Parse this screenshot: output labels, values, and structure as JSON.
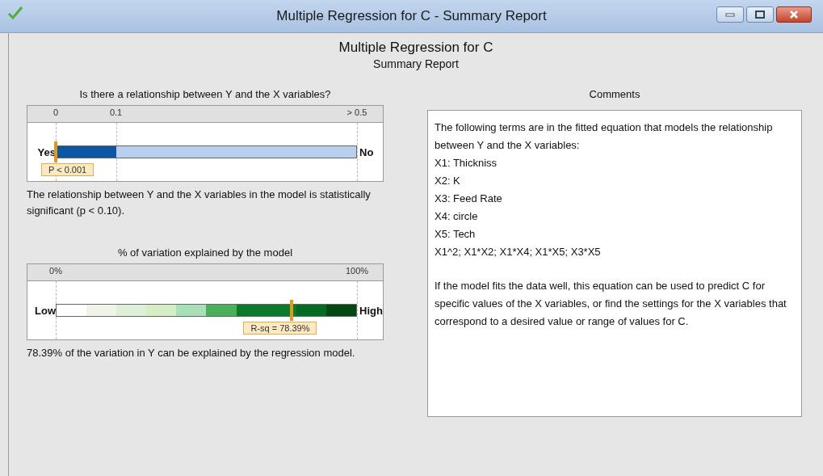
{
  "window": {
    "title": "Multiple Regression for C - Summary Report"
  },
  "report": {
    "title": "Multiple Regression for C",
    "subtitle": "Summary Report"
  },
  "relationship": {
    "question": "Is there a relationship between Y and the X variables?",
    "ticks": [
      "0",
      "0.1",
      "> 0.5"
    ],
    "left_label": "Yes",
    "right_label": "No",
    "level": 0,
    "marker_label": "P < 0.001",
    "conclusion": "The relationship between Y and the X variables in the model is statistically significant (p < 0.10)."
  },
  "variation": {
    "title": "% of variation explained by the model",
    "ticks": [
      "0%",
      "100%"
    ],
    "left_label": "Low",
    "right_label": "High",
    "level": 0.7839,
    "marker_label": "R-sq = 78.39%",
    "conclusion": "78.39% of the variation in Y can be explained by the regression model."
  },
  "comments": {
    "title": "Comments",
    "paragraphs": [
      [
        "The following terms are in the fitted equation that models the relationship between Y and the X variables:",
        "X1: Thickniss",
        "X2: K",
        "X3: Feed Rate",
        "X4: circle",
        "X5: Tech",
        "X1^2; X1*X2; X1*X4; X1*X5; X3*X5"
      ],
      [
        "If the model fits the data well, this equation can be used to predict C for specific values of the X variables, or find the settings for the X variables that correspond to a desired value or range of values for C."
      ]
    ]
  }
}
